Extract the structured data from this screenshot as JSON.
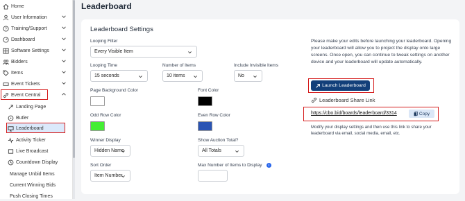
{
  "sidebar": {
    "items": [
      {
        "label": "Home",
        "icon": "home-icon"
      },
      {
        "label": "User Information",
        "icon": "user-icon"
      },
      {
        "label": "Training/Support",
        "icon": "help-circle-icon"
      },
      {
        "label": "Dashboard",
        "icon": "dashboard-icon"
      },
      {
        "label": "Software Settings",
        "icon": "grid-icon"
      },
      {
        "label": "Bidders",
        "icon": "bidders-icon"
      },
      {
        "label": "Items",
        "icon": "tag-icon"
      },
      {
        "label": "Event Tickets",
        "icon": "ticket-icon"
      },
      {
        "label": "Event Central",
        "icon": "link-icon"
      }
    ],
    "sub_items": [
      {
        "label": "Landing Page",
        "icon": "landing-icon"
      },
      {
        "label": "Butler",
        "icon": "butler-icon"
      },
      {
        "label": "Leaderboard",
        "icon": "monitor-icon"
      },
      {
        "label": "Activity Ticker",
        "icon": "ticker-icon"
      },
      {
        "label": "Live Broadcast",
        "icon": "broadcast-icon"
      },
      {
        "label": "Countdown Display",
        "icon": "clock-icon"
      }
    ],
    "plain_items": [
      "Manage Unbid Items",
      "Current Winning Bids",
      "Push Closing Times"
    ]
  },
  "page": {
    "title": "Leaderboard"
  },
  "settings": {
    "title": "Leaderboard Settings",
    "looping_filter": {
      "label": "Looping Filter",
      "value": "Every Visible Item"
    },
    "looping_time": {
      "label": "Looping Time",
      "value": "15 seconds"
    },
    "number_of_items": {
      "label": "Number of Items",
      "value": "10 items"
    },
    "include_invisible": {
      "label": "Include Invisible Items",
      "value": "No"
    },
    "page_bg_color": {
      "label": "Page Background Color",
      "color": "#ffffff"
    },
    "font_color": {
      "label": "Font Color",
      "color": "#000000"
    },
    "odd_row_color": {
      "label": "Odd Row Color",
      "color": "#44ee33"
    },
    "even_row_color": {
      "label": "Even Row Color",
      "color": "#2a54b4"
    },
    "winner_display": {
      "label": "Winner Display",
      "value": "Hidden Name"
    },
    "show_auction_total": {
      "label": "Show Auction Total?",
      "value": "All Totals"
    },
    "sort_order": {
      "label": "Sort Order",
      "value": "Item Number"
    },
    "max_items": {
      "label": "Max Number of Items to Display",
      "value": ""
    }
  },
  "launch": {
    "description": "Please make your edits before launching your leaderboard. Opening your leaderboard will allow you to project the display onto large screens. Once open, you can continue to tweak settings on another device and your leaderboard will update automatically.",
    "button_label": "Launch Leaderboard"
  },
  "share": {
    "heading": "Leaderboard Share Link",
    "url": "https://cbo.bid/boards/leaderboard/3314",
    "copy_label": "Copy",
    "description": "Modify your display settings and then use this link to share your leaderboard via email, social media, email, etc."
  },
  "colors": {
    "accent": "#123f7a",
    "highlight": "#d51b1b",
    "active_bg": "#dbe9fb"
  }
}
